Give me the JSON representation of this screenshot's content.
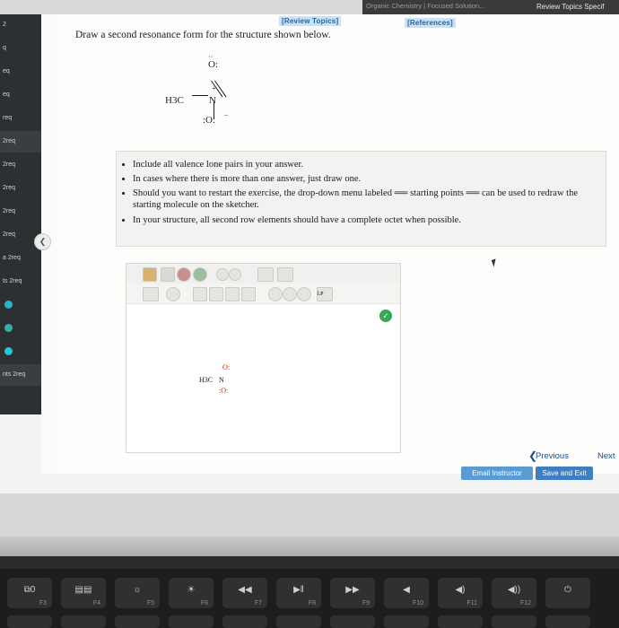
{
  "window": {
    "top_partial_text": "Organic Chemistry | Focused Solution...",
    "top_right_tab": "Review Topics Specif"
  },
  "left_sidebar": {
    "items": [
      {
        "label": "2"
      },
      {
        "label": "q"
      },
      {
        "label": "eq"
      },
      {
        "label": "eq"
      },
      {
        "label": "req"
      },
      {
        "label": "2req"
      },
      {
        "label": "2req"
      },
      {
        "label": "2req"
      },
      {
        "label": "2req"
      },
      {
        "label": "2req"
      },
      {
        "label": "a  2req"
      },
      {
        "label": "ts  2req"
      },
      {
        "label": ""
      },
      {
        "label": ""
      },
      {
        "label": "nts   2req"
      }
    ]
  },
  "header_links": {
    "review_topics": "[Review Topics]",
    "references": "[References]"
  },
  "question": {
    "prompt": "Draw a second resonance form for the structure shown below.",
    "structure": {
      "left_label": "H3C",
      "center_atom": "N",
      "center_charge": "+",
      "top_atom": "O:",
      "top_lone_pair_dots": "··",
      "bottom_atom": ":O:",
      "bottom_charge": "−"
    }
  },
  "instructions": {
    "bullets": [
      "Include all valence lone pairs in your answer.",
      "In cases where there is more than one answer, just draw one.",
      "Should you want to restart the exercise, the drop-down menu labeled ══ starting points ══ can be used to redraw the starting molecule on the sketcher.",
      "In your structure, all second row elements should have a complete octet when possible."
    ],
    "dropdown_label": "starting points"
  },
  "sketcher": {
    "toolbar_icons": [
      "eraser-icon",
      "clean-icon",
      "undo-icon",
      "redo-icon",
      "zoom-in-icon",
      "zoom-out-icon",
      "carbon-template-icon",
      "periodic-table-icon"
    ],
    "toolbar2_icons": [
      "carbon-atom-tool",
      "charge-tool",
      "single-bond-tool",
      "double-bond-tool",
      "triple-bond-tool",
      "wedge-bond-tool",
      "ring-tool",
      "benzene-tool",
      "lone-pair-tool"
    ],
    "atom_button_label": "C",
    "lone_pair_button_label": "l.P",
    "canvas_structure": {
      "left_label": "H3C",
      "center_atom": "N",
      "top_atom": "O:",
      "bottom_atom": ":O:"
    },
    "status_badge": "✓"
  },
  "navigation": {
    "previous": "Previous",
    "next": "Next",
    "prev_chevron": "❮",
    "next_chevron": "❯"
  },
  "footer_buttons": {
    "email_instructor": "Email Instructor",
    "save_and_exit": "Save and Exit"
  },
  "collapse_handle": "❮",
  "keyboard": {
    "keys": [
      {
        "glyph": "⧉0",
        "fk": "F3"
      },
      {
        "glyph": "▤▤",
        "fk": "F4"
      },
      {
        "glyph": "☼",
        "fk": "F5"
      },
      {
        "glyph": "☀",
        "fk": "F6"
      },
      {
        "glyph": "◀◀",
        "fk": "F7"
      },
      {
        "glyph": "▶ǁ",
        "fk": "F8"
      },
      {
        "glyph": "▶▶",
        "fk": "F9"
      },
      {
        "glyph": "◀",
        "fk": "F10"
      },
      {
        "glyph": "◀)",
        "fk": "F11"
      },
      {
        "glyph": "◀))",
        "fk": "F12"
      },
      {
        "glyph": "⏻",
        "fk": ""
      }
    ]
  },
  "colors": {
    "link_blue": "#1668b3",
    "button_blue": "#5b9bd5",
    "save_blue": "#3f7fc1",
    "badge_green": "#34a853",
    "sidebar_dark": "#2d3033"
  }
}
